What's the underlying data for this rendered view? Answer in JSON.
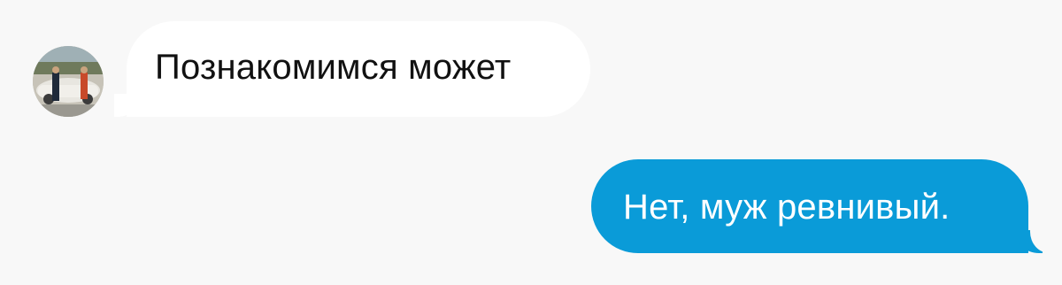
{
  "messages": [
    {
      "direction": "incoming",
      "text": "Познакомимся может",
      "avatar_icon": "contact-photo"
    },
    {
      "direction": "outgoing",
      "text": "Нет, муж ревнивый."
    }
  ],
  "colors": {
    "background": "#f8f8f8",
    "incoming_bubble": "#ffffff",
    "incoming_text": "#111111",
    "outgoing_bubble": "#0a9bd8",
    "outgoing_text": "#ffffff"
  }
}
